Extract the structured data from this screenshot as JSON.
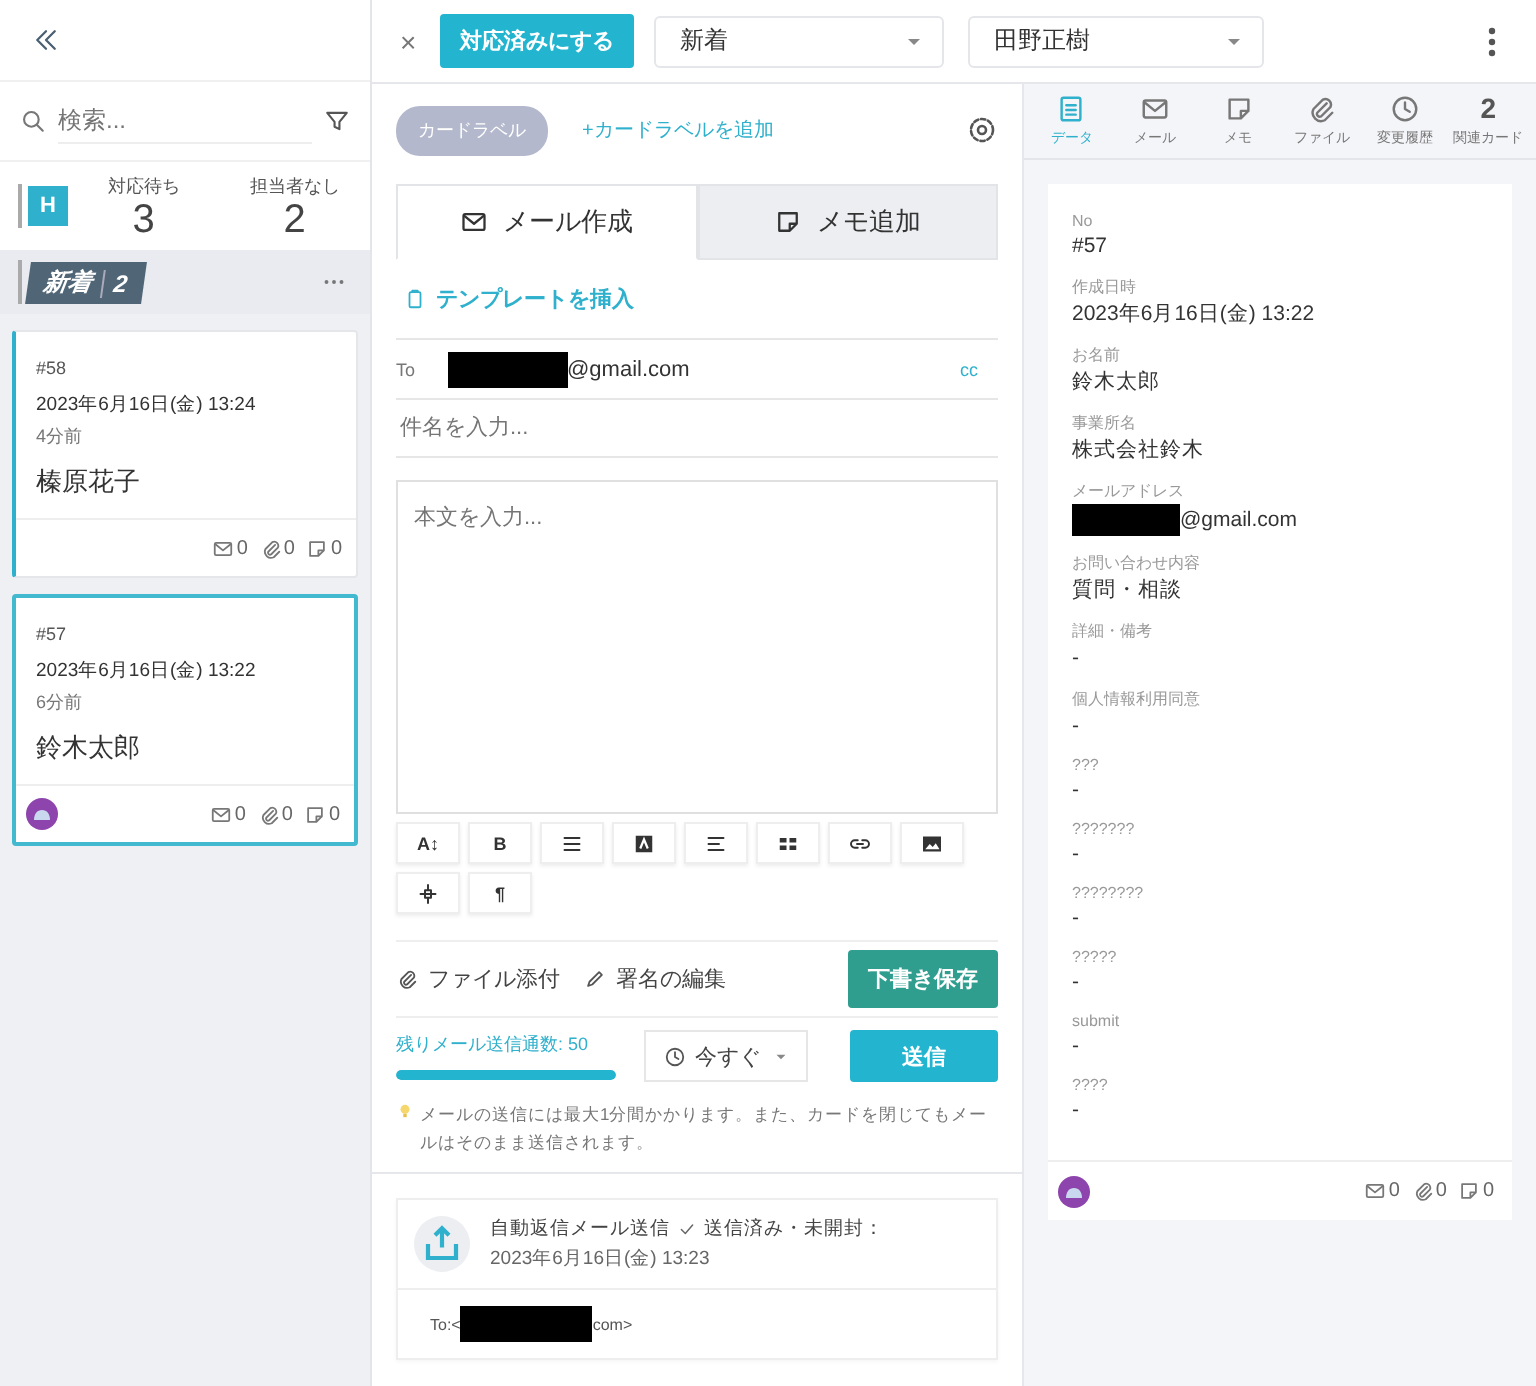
{
  "sidebar": {
    "search": {
      "placeholder": "検索..."
    },
    "badge": "H",
    "stats": [
      {
        "label": "対応待ち",
        "count": "3"
      },
      {
        "label": "担当者なし",
        "count": "2"
      }
    ],
    "column": {
      "title": "新着",
      "count": "2"
    },
    "cards": [
      {
        "no": "#58",
        "date": "2023年6月16日(金) 13:24",
        "ago": "4分前",
        "name": "榛原花子",
        "unread": true,
        "selected": false,
        "avatar": false,
        "counts": [
          "0",
          "0",
          "0"
        ]
      },
      {
        "no": "#57",
        "date": "2023年6月16日(金) 13:22",
        "ago": "6分前",
        "name": "鈴木太郎",
        "unread": false,
        "selected": true,
        "avatar": true,
        "counts": [
          "0",
          "0",
          "0"
        ]
      }
    ]
  },
  "toolbar": {
    "close": "×",
    "done_button": "対応済みにする",
    "status": "新着",
    "assignee": "田野正樹"
  },
  "composer": {
    "label_chip": "カードラベル",
    "add_label": "+カードラベルを追加",
    "tabs": [
      {
        "label": "メール作成",
        "selected": true
      },
      {
        "label": "メモ追加",
        "selected": false
      }
    ],
    "template": "テンプレートを挿入",
    "to_label": "To",
    "to_redacted": true,
    "to_suffix": "@gmail.com",
    "cc": "cc",
    "subject": {
      "placeholder": "件名を入力..."
    },
    "body": {
      "placeholder": "本文を入力..."
    },
    "format_tools": [
      {
        "kind": "text",
        "label": "A↕"
      },
      {
        "kind": "text",
        "label": "B"
      },
      {
        "kind": "list"
      },
      {
        "kind": "highlight"
      },
      {
        "kind": "align"
      },
      {
        "kind": "table"
      },
      {
        "kind": "link"
      },
      {
        "kind": "image"
      },
      {
        "kind": "divider"
      },
      {
        "kind": "text",
        "label": "¶"
      }
    ],
    "attach": "ファイル添付",
    "signature": "署名の編集",
    "draft_button": "下書き保存",
    "quota": {
      "text": "残りメール送信通数: 50",
      "level": 1
    },
    "schedule": "今すぐ",
    "send_button": "送信",
    "note": "メールの送信には最大1分間かかります。また、カードを閉じてもメールはそのまま送信されます。",
    "history": {
      "title": "自動返信メール送信",
      "status": "送信済み・未開封：",
      "date": "2023年6月16日(金) 13:23",
      "to_prefix": "To:<",
      "to_suffix": "com>"
    }
  },
  "detail": {
    "tabs": [
      {
        "label": "データ",
        "selected": true
      },
      {
        "label": "メール",
        "selected": false
      },
      {
        "label": "メモ",
        "selected": false
      },
      {
        "label": "ファイル",
        "selected": false
      },
      {
        "label": "変更履歴",
        "selected": false
      },
      {
        "label": "関連カード",
        "count": "2",
        "selected": false
      }
    ],
    "fields": [
      {
        "label": "No",
        "value": "#57"
      },
      {
        "label": "作成日時",
        "value": "2023年6月16日(金) 13:22"
      },
      {
        "label": "お名前",
        "value": "鈴木太郎"
      },
      {
        "label": "事業所名",
        "value": "株式会社鈴木"
      },
      {
        "label": "メールアドレス",
        "value": "@gmail.com",
        "redacted": true
      },
      {
        "label": "お問い合わせ内容",
        "value": "質問・相談"
      },
      {
        "label": "詳細・備考",
        "value": "-"
      },
      {
        "label": "個人情報利用同意",
        "value": "-"
      },
      {
        "label": "???",
        "value": "-"
      },
      {
        "label": "???????",
        "value": "-"
      },
      {
        "label": "????????",
        "value": "-"
      },
      {
        "label": "?????",
        "value": "-"
      },
      {
        "label": "submit",
        "value": "-"
      },
      {
        "label": "????",
        "value": "-"
      }
    ],
    "avatar": true,
    "counts": [
      "0",
      "0",
      "0"
    ]
  }
}
